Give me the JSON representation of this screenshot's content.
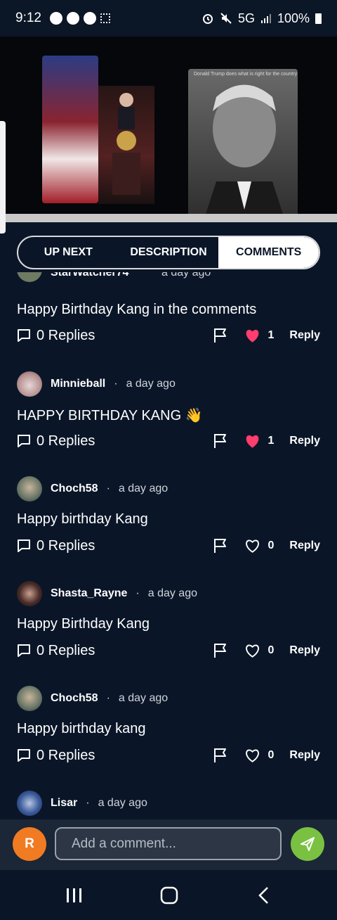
{
  "status_bar": {
    "time": "9:12",
    "network": "5G",
    "battery": "100%"
  },
  "video": {
    "thumbnail_caption": "Donald Trump does what is right for the country"
  },
  "tabs": [
    {
      "label": "UP NEXT",
      "active": false
    },
    {
      "label": "DESCRIPTION",
      "active": false
    },
    {
      "label": "COMMENTS",
      "active": true
    }
  ],
  "partial_comment": {
    "name": "StarWatcher74",
    "time": "a day ago"
  },
  "comments": [
    {
      "name": "",
      "time": "",
      "text": "Happy Birthday Kang in the comments",
      "replies": "0 Replies",
      "likes": "1",
      "liked": true,
      "reply_label": "Reply"
    },
    {
      "name": "Minnieball",
      "time": "a day ago",
      "text": "HAPPY BIRTHDAY KANG 👋",
      "replies": "0 Replies",
      "likes": "1",
      "liked": true,
      "reply_label": "Reply"
    },
    {
      "name": "Choch58",
      "time": "a day ago",
      "text": "Happy birthday Kang",
      "replies": "0 Replies",
      "likes": "0",
      "liked": false,
      "reply_label": "Reply"
    },
    {
      "name": "Shasta_Rayne",
      "time": "a day ago",
      "text": "Happy Birthday Kang",
      "replies": "0 Replies",
      "likes": "0",
      "liked": false,
      "reply_label": "Reply"
    },
    {
      "name": "Choch58",
      "time": "a day ago",
      "text": "Happy birthday kang",
      "replies": "0 Replies",
      "likes": "0",
      "liked": false,
      "reply_label": "Reply"
    },
    {
      "name": "Lisar",
      "time": "a day ago"
    }
  ],
  "comment_bar": {
    "user_initial": "R",
    "placeholder": "Add a comment..."
  },
  "colors": {
    "background": "#0a1628",
    "heart_liked": "#ff3d6e",
    "send_button": "#7ac142",
    "user_avatar": "#f07b23"
  }
}
